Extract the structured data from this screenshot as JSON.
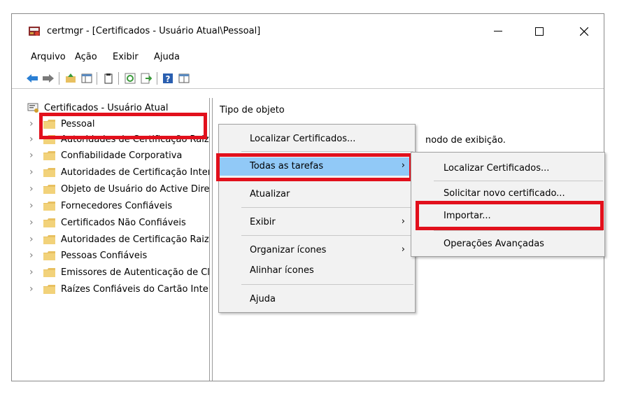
{
  "window": {
    "title": "certmgr - [Certificados - Usuário Atual\\Pessoal]",
    "controls": {
      "minimize": "—",
      "maximize": "☐",
      "close": "✕"
    }
  },
  "menu": [
    "Arquivo",
    "Ação",
    "Exibir",
    "Ajuda"
  ],
  "toolbar": {
    "icons": [
      "back-arrow-icon",
      "forward-arrow-icon",
      "up-folder-icon",
      "show-hide-tree-icon",
      "clipboard-icon",
      "refresh-icon",
      "export-list-icon",
      "help-icon",
      "properties-icon"
    ]
  },
  "tree": {
    "root": "Certificados - Usuário Atual",
    "items": [
      "Pessoal",
      "Autoridades de Certificação Raiz Confiáveis",
      "Confiabilidade Corporativa",
      "Autoridades de Certificação Intermediárias",
      "Objeto de Usuário do Active Directory",
      "Fornecedores Confiáveis",
      "Certificados Não Confiáveis",
      "Autoridades de Certificação Raiz de Terceiros",
      "Pessoas Confiáveis",
      "Emissores de Autenticação de Cliente",
      "Raízes Confiáveis do Cartão Inteligente"
    ]
  },
  "detail": {
    "header": "Tipo de objeto",
    "message": "nodo de exibição."
  },
  "context_menu": {
    "items": [
      {
        "label": "Localizar Certificados...",
        "arrow": ""
      },
      {
        "label": "Todas as tarefas",
        "arrow": "›"
      },
      {
        "label": "Atualizar",
        "arrow": ""
      },
      {
        "label": "Exibir",
        "arrow": "›"
      },
      {
        "label": "Organizar ícones",
        "arrow": "›"
      },
      {
        "label": "Alinhar ícones",
        "arrow": ""
      },
      {
        "label": "Ajuda",
        "arrow": ""
      }
    ]
  },
  "submenu": {
    "items": [
      "Localizar Certificados...",
      "Solicitar novo certificado...",
      "Importar...",
      "Operações Avançadas"
    ]
  },
  "colors": {
    "highlight": "#91c9f7",
    "annotation_red": "#e2101c",
    "menu_bg": "#f2f2f2",
    "folder": "#e8c060"
  }
}
